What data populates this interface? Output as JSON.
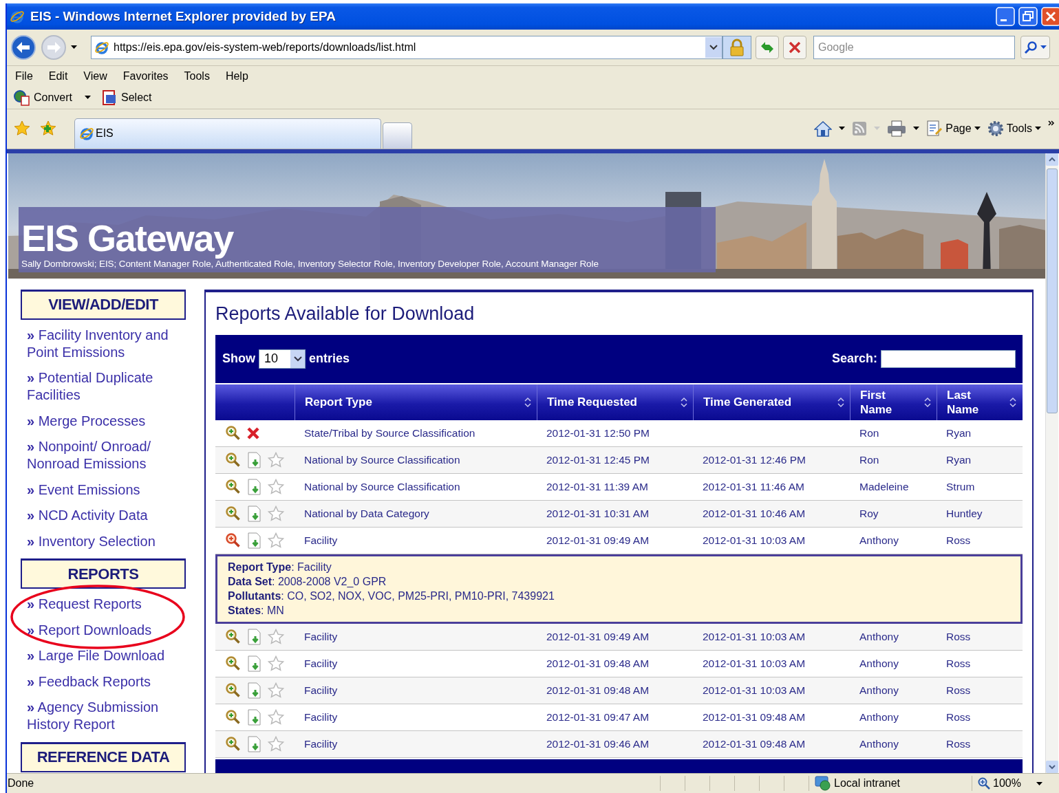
{
  "window": {
    "title": "EIS - Windows Internet Explorer provided by EPA"
  },
  "address_bar": {
    "url": "https://eis.epa.gov/eis-system-web/reports/downloads/list.html"
  },
  "search_box": {
    "placeholder": "Google"
  },
  "menu_bar": [
    "File",
    "Edit",
    "View",
    "Favorites",
    "Tools",
    "Help"
  ],
  "pdf_toolbar": [
    "Convert",
    "Select"
  ],
  "tabs": [
    {
      "label": "EIS",
      "selected": true
    }
  ],
  "command_bar": [
    "Page",
    "Tools"
  ],
  "banner": {
    "title": "EIS Gateway",
    "roles": "Sally Dombrowski; EIS; Content Manager Role, Authenticated Role, Inventory Selector Role, Inventory Developer Role, Account Manager Role"
  },
  "sidebar": [
    {
      "heading": "VIEW/ADD/EDIT",
      "items": [
        "**»** Facility Inventory and Point Emissions",
        "**»** Potential Duplicate Facilities",
        "**»** Merge Processes",
        "**»** Nonpoint/ Onroad/ Nonroad Emissions",
        "**»** Event Emissions",
        "**»** NCD Activity Data",
        "**»** Inventory Selection"
      ]
    },
    {
      "heading": "REPORTS",
      "items": [
        "**»** Request Reports",
        "**»** Report Downloads",
        "**»** Large File Download",
        "**»** Feedback Reports",
        "**»** Agency Submission History Report"
      ]
    },
    {
      "heading": "REFERENCE DATA"
    }
  ],
  "reports": {
    "title": "Reports Available for Download",
    "show_label": "Show",
    "page_size": "10",
    "entries_label": "entries",
    "search_label": "Search:",
    "columns": [
      "Report Type",
      "Time Requested",
      "Time Generated",
      "First Name",
      "Last Name"
    ],
    "rows": [
      {
        "kind": "pending",
        "expanded": false,
        "report_type": "State/Tribal by Source Classification",
        "time_requested": "2012-01-31 12:50 PM",
        "first_name": "Ron",
        "last_name": "Ryan"
      },
      {
        "kind": "ready",
        "expanded": false,
        "report_type": "National by Source Classification",
        "time_requested": "2012-01-31 12:45 PM",
        "time_generated": "2012-01-31 12:46 PM",
        "first_name": "Ron",
        "last_name": "Ryan"
      },
      {
        "kind": "ready",
        "expanded": false,
        "report_type": "National by Source Classification",
        "time_requested": "2012-01-31 11:39 AM",
        "time_generated": "2012-01-31 11:46 AM",
        "first_name": "Madeleine",
        "last_name": "Strum"
      },
      {
        "kind": "ready",
        "expanded": false,
        "report_type": "National by Data Category",
        "time_requested": "2012-01-31 10:31 AM",
        "time_generated": "2012-01-31 10:46 AM",
        "first_name": "Roy",
        "last_name": "Huntley"
      },
      {
        "kind": "ready",
        "expanded": true,
        "report_type": "Facility",
        "time_requested": "2012-01-31 09:49 AM",
        "time_generated": "2012-01-31 10:03 AM",
        "first_name": "Anthony",
        "last_name": "Ross",
        "details": [
          "**Report Type**: Facility",
          "**Data Set**: 2008-2008 V2_0 GPR",
          "**Pollutants**: CO, SO2, NOX, VOC, PM25-PRI, PM10-PRI, 7439921",
          "**States**: MN"
        ]
      },
      {
        "kind": "ready",
        "expanded": false,
        "report_type": "Facility",
        "time_requested": "2012-01-31 09:49 AM",
        "time_generated": "2012-01-31 10:03 AM",
        "first_name": "Anthony",
        "last_name": "Ross"
      },
      {
        "kind": "ready",
        "expanded": false,
        "report_type": "Facility",
        "time_requested": "2012-01-31 09:48 AM",
        "time_generated": "2012-01-31 10:03 AM",
        "first_name": "Anthony",
        "last_name": "Ross"
      },
      {
        "kind": "ready",
        "expanded": false,
        "report_type": "Facility",
        "time_requested": "2012-01-31 09:48 AM",
        "time_generated": "2012-01-31 10:03 AM",
        "first_name": "Anthony",
        "last_name": "Ross"
      },
      {
        "kind": "ready",
        "expanded": false,
        "report_type": "Facility",
        "time_requested": "2012-01-31 09:47 AM",
        "time_generated": "2012-01-31 09:48 AM",
        "first_name": "Anthony",
        "last_name": "Ross"
      },
      {
        "kind": "ready",
        "expanded": false,
        "report_type": "Facility",
        "time_requested": "2012-01-31 09:46 AM",
        "time_generated": "2012-01-31 09:48 AM",
        "first_name": "Anthony",
        "last_name": "Ross"
      }
    ]
  },
  "status_bar": {
    "text": "Done",
    "zone": "Local intranet",
    "zoom": "100%"
  }
}
